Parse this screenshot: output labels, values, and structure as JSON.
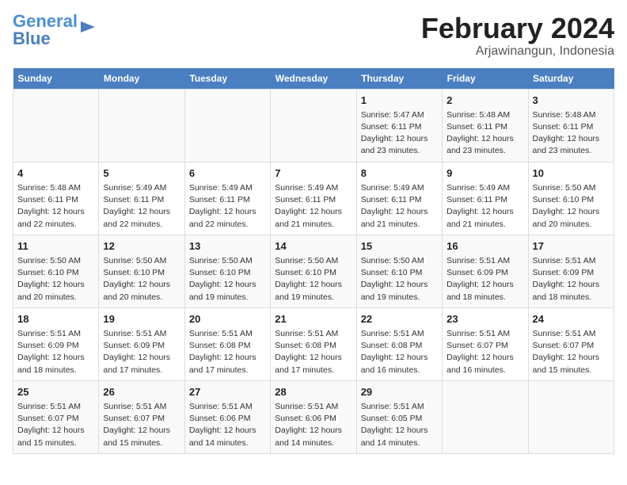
{
  "logo": {
    "line1": "General",
    "line2": "Blue"
  },
  "title": "February 2024",
  "subtitle": "Arjawinangun, Indonesia",
  "weekdays": [
    "Sunday",
    "Monday",
    "Tuesday",
    "Wednesday",
    "Thursday",
    "Friday",
    "Saturday"
  ],
  "weeks": [
    [
      {
        "day": "",
        "info": ""
      },
      {
        "day": "",
        "info": ""
      },
      {
        "day": "",
        "info": ""
      },
      {
        "day": "",
        "info": ""
      },
      {
        "day": "1",
        "info": "Sunrise: 5:47 AM\nSunset: 6:11 PM\nDaylight: 12 hours\nand 23 minutes."
      },
      {
        "day": "2",
        "info": "Sunrise: 5:48 AM\nSunset: 6:11 PM\nDaylight: 12 hours\nand 23 minutes."
      },
      {
        "day": "3",
        "info": "Sunrise: 5:48 AM\nSunset: 6:11 PM\nDaylight: 12 hours\nand 23 minutes."
      }
    ],
    [
      {
        "day": "4",
        "info": "Sunrise: 5:48 AM\nSunset: 6:11 PM\nDaylight: 12 hours\nand 22 minutes."
      },
      {
        "day": "5",
        "info": "Sunrise: 5:49 AM\nSunset: 6:11 PM\nDaylight: 12 hours\nand 22 minutes."
      },
      {
        "day": "6",
        "info": "Sunrise: 5:49 AM\nSunset: 6:11 PM\nDaylight: 12 hours\nand 22 minutes."
      },
      {
        "day": "7",
        "info": "Sunrise: 5:49 AM\nSunset: 6:11 PM\nDaylight: 12 hours\nand 21 minutes."
      },
      {
        "day": "8",
        "info": "Sunrise: 5:49 AM\nSunset: 6:11 PM\nDaylight: 12 hours\nand 21 minutes."
      },
      {
        "day": "9",
        "info": "Sunrise: 5:49 AM\nSunset: 6:11 PM\nDaylight: 12 hours\nand 21 minutes."
      },
      {
        "day": "10",
        "info": "Sunrise: 5:50 AM\nSunset: 6:10 PM\nDaylight: 12 hours\nand 20 minutes."
      }
    ],
    [
      {
        "day": "11",
        "info": "Sunrise: 5:50 AM\nSunset: 6:10 PM\nDaylight: 12 hours\nand 20 minutes."
      },
      {
        "day": "12",
        "info": "Sunrise: 5:50 AM\nSunset: 6:10 PM\nDaylight: 12 hours\nand 20 minutes."
      },
      {
        "day": "13",
        "info": "Sunrise: 5:50 AM\nSunset: 6:10 PM\nDaylight: 12 hours\nand 19 minutes."
      },
      {
        "day": "14",
        "info": "Sunrise: 5:50 AM\nSunset: 6:10 PM\nDaylight: 12 hours\nand 19 minutes."
      },
      {
        "day": "15",
        "info": "Sunrise: 5:50 AM\nSunset: 6:10 PM\nDaylight: 12 hours\nand 19 minutes."
      },
      {
        "day": "16",
        "info": "Sunrise: 5:51 AM\nSunset: 6:09 PM\nDaylight: 12 hours\nand 18 minutes."
      },
      {
        "day": "17",
        "info": "Sunrise: 5:51 AM\nSunset: 6:09 PM\nDaylight: 12 hours\nand 18 minutes."
      }
    ],
    [
      {
        "day": "18",
        "info": "Sunrise: 5:51 AM\nSunset: 6:09 PM\nDaylight: 12 hours\nand 18 minutes."
      },
      {
        "day": "19",
        "info": "Sunrise: 5:51 AM\nSunset: 6:09 PM\nDaylight: 12 hours\nand 17 minutes."
      },
      {
        "day": "20",
        "info": "Sunrise: 5:51 AM\nSunset: 6:08 PM\nDaylight: 12 hours\nand 17 minutes."
      },
      {
        "day": "21",
        "info": "Sunrise: 5:51 AM\nSunset: 6:08 PM\nDaylight: 12 hours\nand 17 minutes."
      },
      {
        "day": "22",
        "info": "Sunrise: 5:51 AM\nSunset: 6:08 PM\nDaylight: 12 hours\nand 16 minutes."
      },
      {
        "day": "23",
        "info": "Sunrise: 5:51 AM\nSunset: 6:07 PM\nDaylight: 12 hours\nand 16 minutes."
      },
      {
        "day": "24",
        "info": "Sunrise: 5:51 AM\nSunset: 6:07 PM\nDaylight: 12 hours\nand 15 minutes."
      }
    ],
    [
      {
        "day": "25",
        "info": "Sunrise: 5:51 AM\nSunset: 6:07 PM\nDaylight: 12 hours\nand 15 minutes."
      },
      {
        "day": "26",
        "info": "Sunrise: 5:51 AM\nSunset: 6:07 PM\nDaylight: 12 hours\nand 15 minutes."
      },
      {
        "day": "27",
        "info": "Sunrise: 5:51 AM\nSunset: 6:06 PM\nDaylight: 12 hours\nand 14 minutes."
      },
      {
        "day": "28",
        "info": "Sunrise: 5:51 AM\nSunset: 6:06 PM\nDaylight: 12 hours\nand 14 minutes."
      },
      {
        "day": "29",
        "info": "Sunrise: 5:51 AM\nSunset: 6:05 PM\nDaylight: 12 hours\nand 14 minutes."
      },
      {
        "day": "",
        "info": ""
      },
      {
        "day": "",
        "info": ""
      }
    ]
  ]
}
